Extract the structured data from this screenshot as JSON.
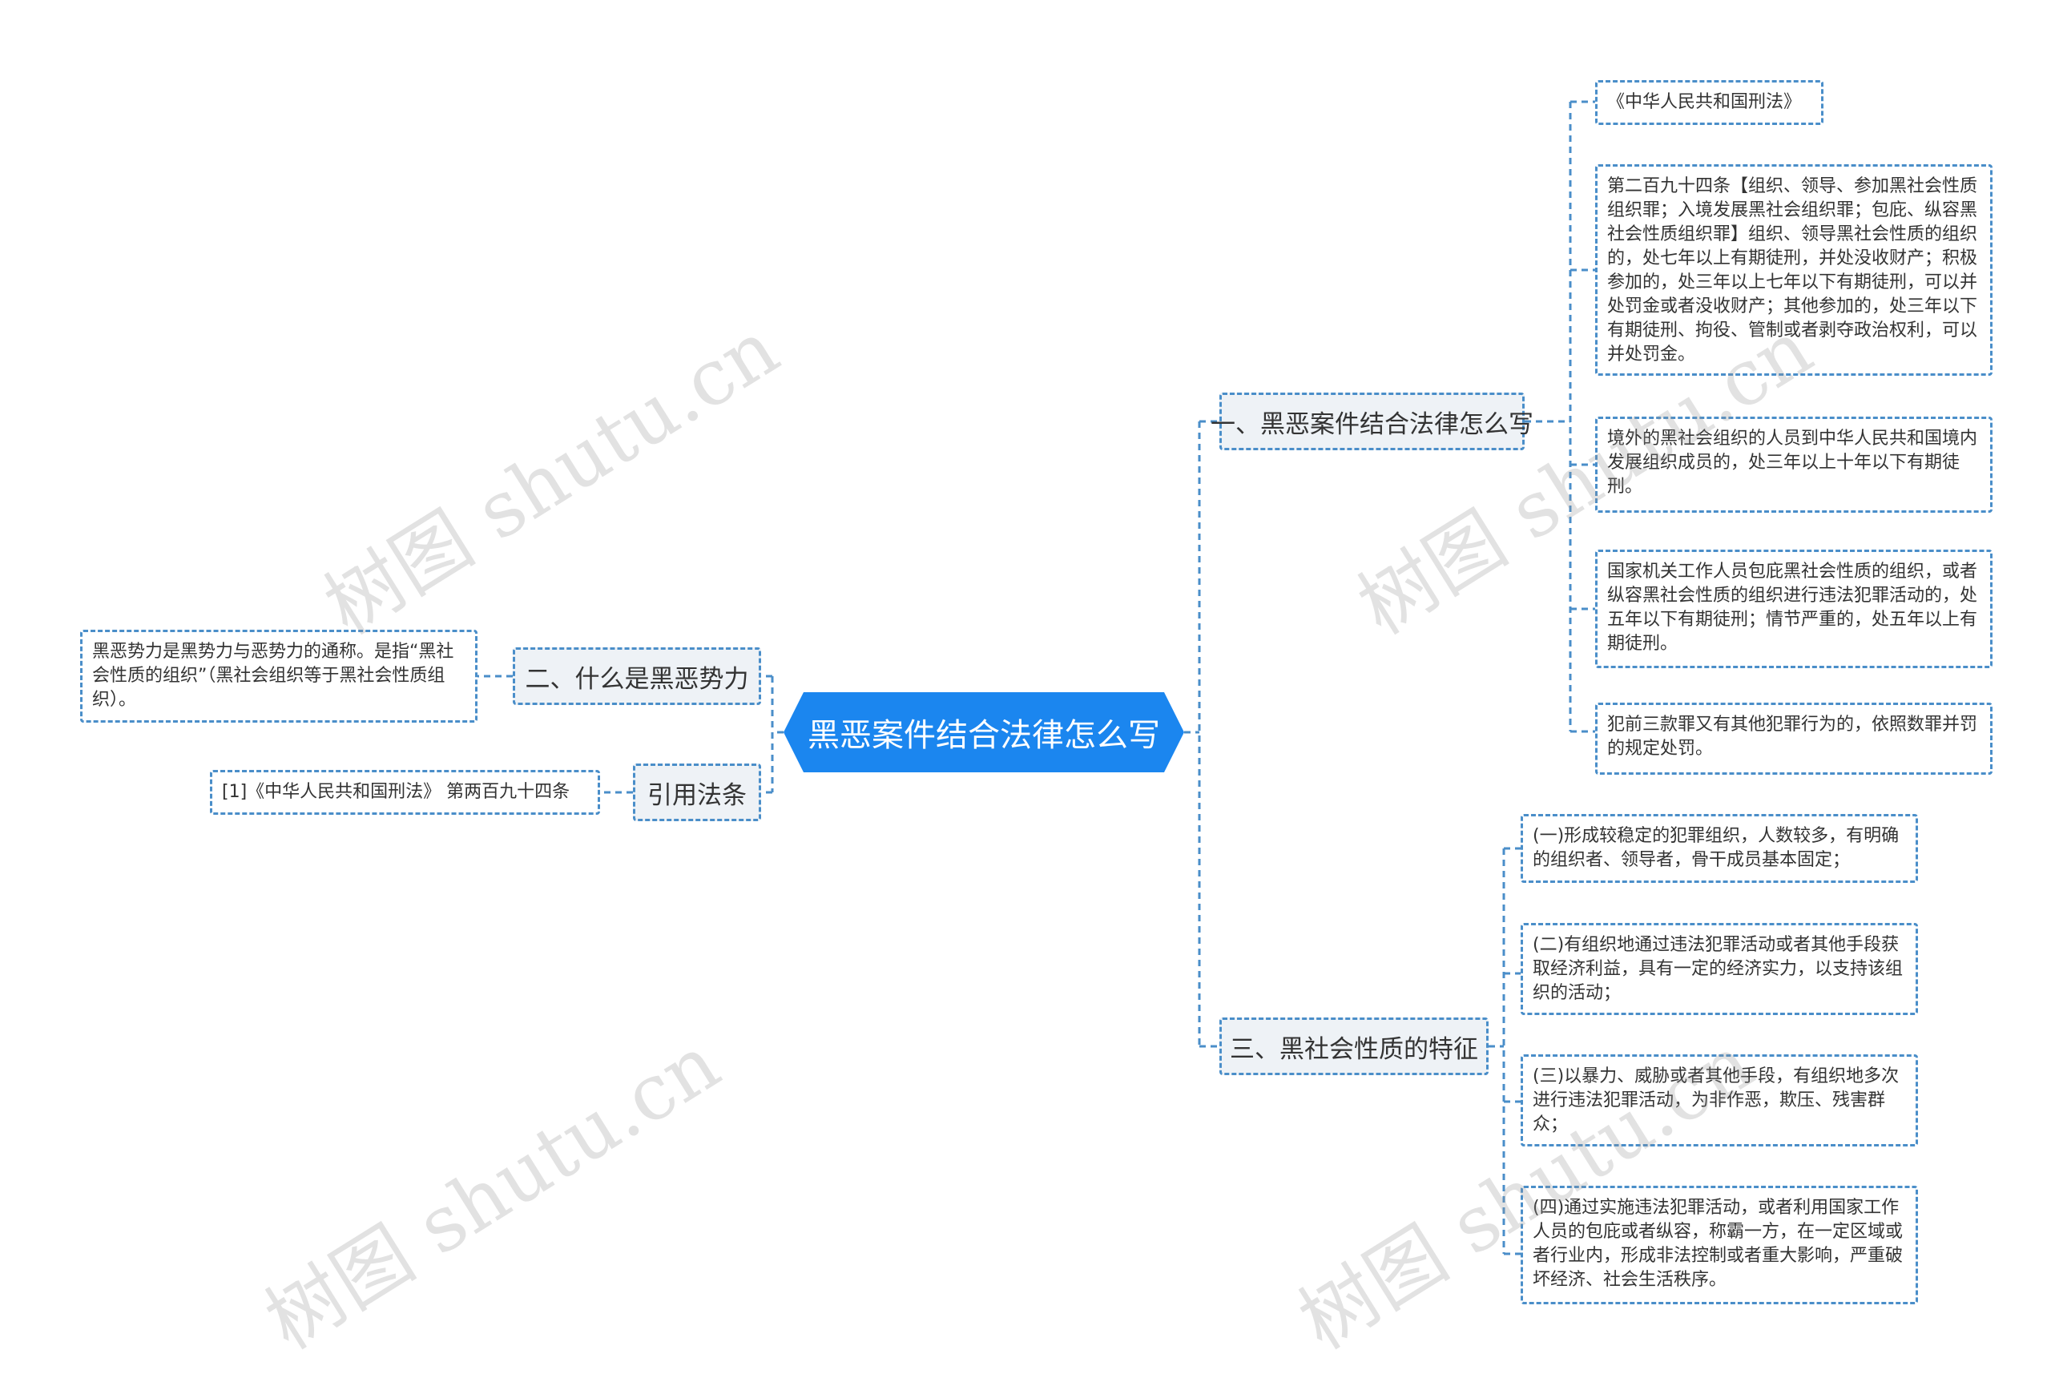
{
  "central": "黑恶案件结合法律怎么写",
  "branches": {
    "b1": "一、黑恶案件结合法律怎么写",
    "b2": "二、什么是黑恶势力",
    "b3": "引用法条",
    "b4": "三、黑社会性质的特征"
  },
  "leaves": {
    "l1": "《中华人民共和国刑法》",
    "l2": "第二百九十四条【组织、领导、参加黑社会性质组织罪；入境发展黑社会组织罪；包庇、纵容黑社会性质组织罪】组织、领导黑社会性质的组织的，处七年以上有期徒刑，并处没收财产；积极参加的，处三年以上七年以下有期徒刑，可以并处罚金或者没收财产；其他参加的，处三年以下有期徒刑、拘役、管制或者剥夺政治权利，可以并处罚金。",
    "l3": "境外的黑社会组织的人员到中华人民共和国境内发展组织成员的，处三年以上十年以下有期徒刑。",
    "l4": "国家机关工作人员包庇黑社会性质的组织，或者纵容黑社会性质的组织进行违法犯罪活动的，处五年以下有期徒刑；情节严重的，处五年以上有期徒刑。",
    "l5": "犯前三款罪又有其他犯罪行为的，依照数罪并罚的规定处罚。",
    "l6": "黑恶势力是黑势力与恶势力的通称。是指“黑社会性质的组织”（黑社会组织等于黑社会性质组织）。",
    "l7": "[1]《中华人民共和国刑法》 第两百九十四条",
    "l8": "(一)形成较稳定的犯罪组织，人数较多，有明确的组织者、领导者，骨干成员基本固定；",
    "l9": "(二)有组织地通过违法犯罪活动或者其他手段获取经济利益，具有一定的经济实力，以支持该组织的活动；",
    "l10": "(三)以暴力、威胁或者其他手段，有组织地多次进行违法犯罪活动，为非作恶，欺压、残害群众；",
    "l11": "(四)通过实施违法犯罪活动，或者利用国家工作人员的包庇或者纵容，称霸一方，在一定区域或者行业内，形成非法控制或者重大影响，严重破坏经济、社会生活秩序。"
  },
  "watermark": "树图 shutu.cn",
  "colors": {
    "central": "#1b86ef",
    "line": "#4a8ec9",
    "branch_bg": "#eef2f6"
  }
}
